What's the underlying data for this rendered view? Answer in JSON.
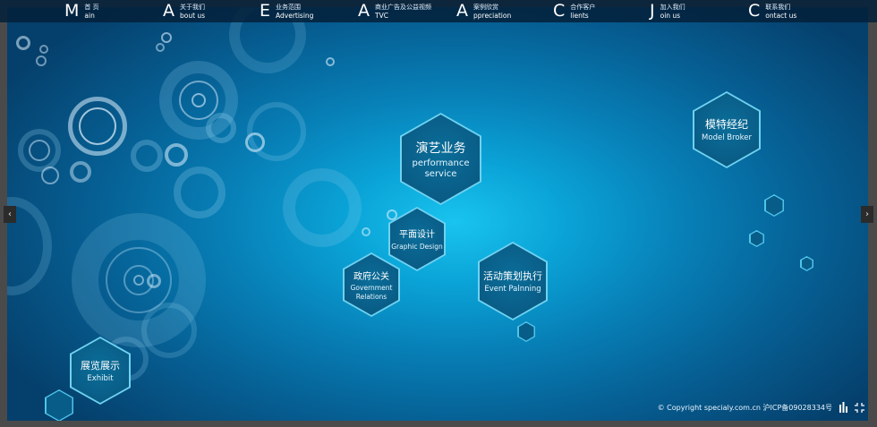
{
  "nav": [
    {
      "letter": "M",
      "cn": "首 页",
      "en": "ain"
    },
    {
      "letter": "A",
      "cn": "关于我们",
      "en": "bout us"
    },
    {
      "letter": "E",
      "cn": "业务范围",
      "en": "Advertising"
    },
    {
      "letter": "A",
      "cn": "商业广告及公益视频",
      "en": "TVC"
    },
    {
      "letter": "A",
      "cn": "案例欣赏",
      "en": "ppreciation"
    },
    {
      "letter": "C",
      "cn": "合作客户",
      "en": "lients"
    },
    {
      "letter": "J",
      "cn": "加入我们",
      "en": "oin us"
    },
    {
      "letter": "C",
      "cn": "联系我们",
      "en": "ontact us"
    }
  ],
  "hexagons": {
    "performance": {
      "cn": "演艺业务",
      "en1": "performance",
      "en2": "service"
    },
    "model": {
      "cn": "模特经纪",
      "en1": "Model Broker"
    },
    "graphic": {
      "cn": "平面设计",
      "en1": "Graphic Design"
    },
    "government": {
      "cn": "政府公关",
      "en1": "Government",
      "en2": "Relations"
    },
    "event": {
      "cn": "活动策划执行",
      "en1": "Event Palnning"
    },
    "exhibit": {
      "cn": "展览展示",
      "en1": "Exhibit"
    }
  },
  "footer": {
    "copyright": "© Copyright specialy.com.cn 沪ICP备09028334号",
    "icon1": "building-icon",
    "icon2": "crop-frame-icon"
  },
  "arrows": {
    "left": "‹",
    "right": "›"
  }
}
